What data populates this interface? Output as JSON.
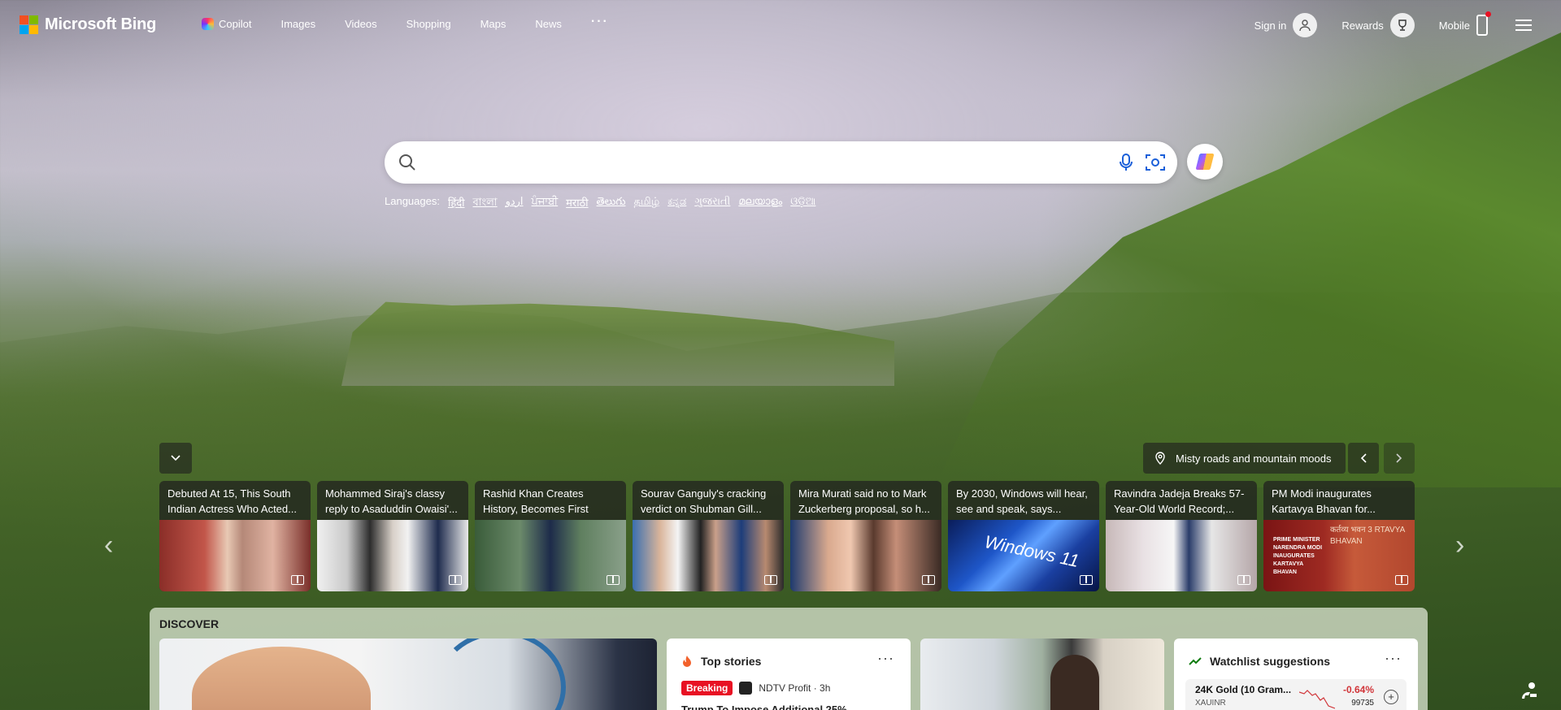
{
  "header": {
    "logo_text": "Microsoft Bing",
    "nav": [
      {
        "label": "Copilot",
        "icon": "copilot-icon"
      },
      {
        "label": "Images"
      },
      {
        "label": "Videos"
      },
      {
        "label": "Shopping"
      },
      {
        "label": "Maps"
      },
      {
        "label": "News"
      }
    ],
    "more": "···",
    "sign_in": "Sign in",
    "rewards": "Rewards",
    "mobile": "Mobile"
  },
  "search": {
    "placeholder": "",
    "value": ""
  },
  "languages": {
    "label": "Languages:",
    "items": [
      "हिंदी",
      "বাংলা",
      "اردو",
      "ਪੰਜਾਬੀ",
      "मराठी",
      "తెలుగు",
      "தமிழ்",
      "ಕನ್ನಡ",
      "ગુજરાતી",
      "മലയാളം",
      "ଓଡ଼ିଆ"
    ]
  },
  "image_caption": "Misty roads and mountain moods",
  "carousel": [
    {
      "title": "Debuted At 15, This South Indian Actress Who Acted..."
    },
    {
      "title": "Mohammed Siraj's classy reply to Asaduddin Owaisi'..."
    },
    {
      "title": "Rashid Khan Creates History, Becomes First Player In..."
    },
    {
      "title": "Sourav Ganguly's cracking verdict on Shubman Gill..."
    },
    {
      "title": "Mira Murati said no to Mark Zuckerberg proposal, so h..."
    },
    {
      "title": "By 2030, Windows will hear, see and speak, says..."
    },
    {
      "title": "Ravindra Jadeja Breaks 57-Year-Old World Record;..."
    },
    {
      "title": "PM Modi inaugurates Kartavya Bhavan for..."
    }
  ],
  "card_overlays": {
    "windows": "Windows 11",
    "modi_text": "PRIME MINISTER NARENDRA MODI INAUGURATES KARTAVYA BHAVAN",
    "modi_sign": "कर्तव्य भवन 3  RTAVYA BHAVAN"
  },
  "discover": {
    "label": "DISCOVER",
    "top_stories": {
      "title": "Top stories",
      "tag": "Breaking",
      "source": "NDTV Profit · 3h",
      "headline": "Trump To Impose Additional 25%"
    },
    "watchlist": {
      "title": "Watchlist suggestions",
      "name": "24K Gold (10 Gram...",
      "symbol": "XAUINR",
      "change": "-0.64%",
      "value": "99735"
    },
    "menu_dots": "···"
  },
  "colors": {
    "breaking": "#e81123",
    "negative": "#d13438"
  }
}
